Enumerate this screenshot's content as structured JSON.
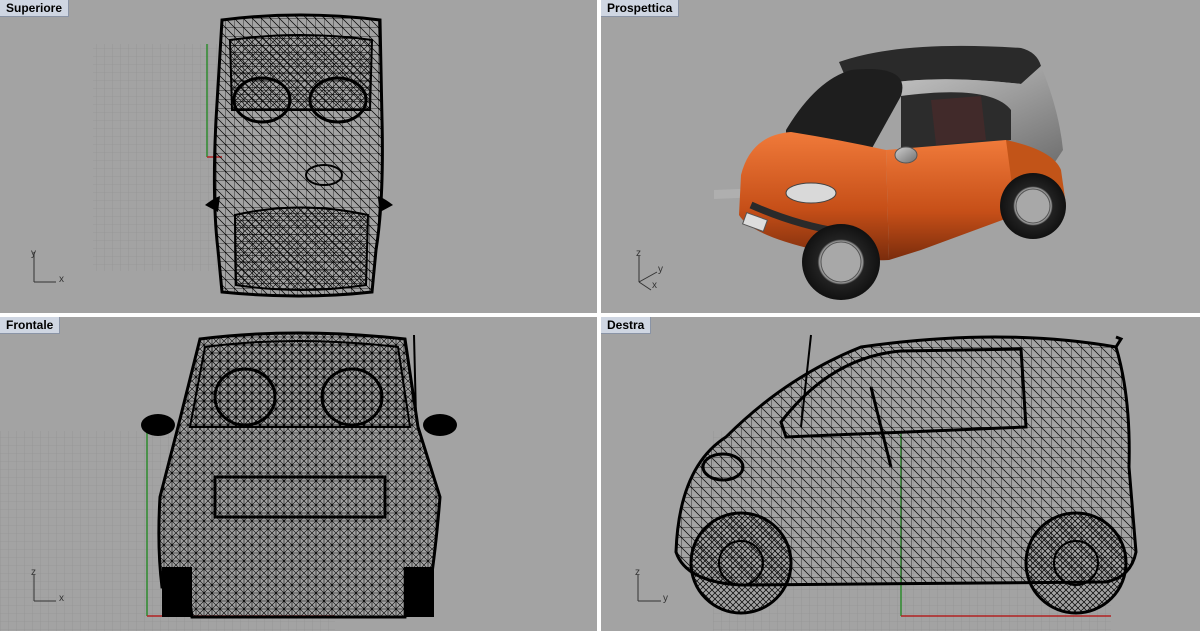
{
  "viewports": {
    "top": {
      "title": "Superiore",
      "axis_vertical": "y",
      "axis_horizontal": "x"
    },
    "persp": {
      "title": "Prospettica",
      "axis_vertical": "z",
      "axis_mid": "y",
      "axis_horizontal": "x"
    },
    "front": {
      "title": "Frontale",
      "axis_vertical": "z",
      "axis_horizontal": "x"
    },
    "right": {
      "title": "Destra",
      "axis_vertical": "z",
      "axis_horizontal": "y"
    }
  },
  "colors": {
    "viewport_bg": "#a3a3a3",
    "grid_line": "#8f8f8f",
    "axis_x": "#b22222",
    "axis_y": "#2e8b2e",
    "wire": "#000000",
    "car_body": "#d45a1f",
    "car_silver": "#9a9a9a",
    "title_bg": "#cfd6e2"
  }
}
